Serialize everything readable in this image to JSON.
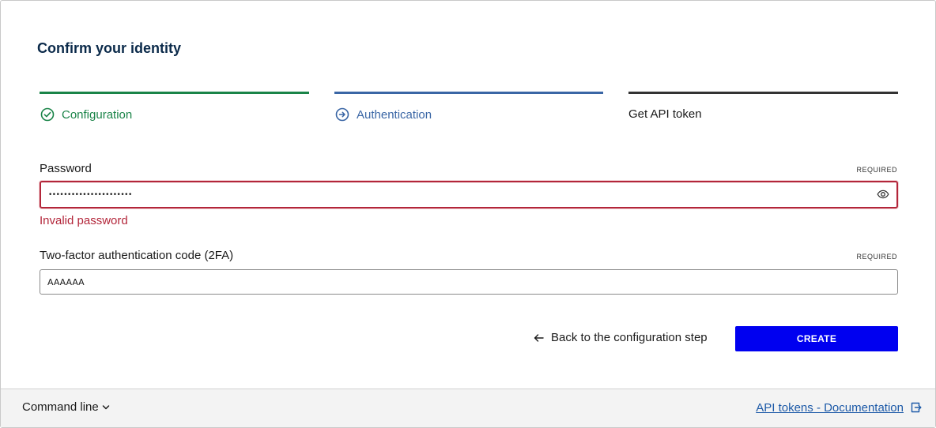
{
  "page": {
    "title": "Confirm your identity"
  },
  "steps": [
    {
      "label": "Configuration",
      "state": "done",
      "color": "#1a8448",
      "icon": "check-circle-icon"
    },
    {
      "label": "Authentication",
      "state": "current",
      "color": "#3a66a5",
      "icon": "arrow-circle-icon"
    },
    {
      "label": "Get API token",
      "state": "pending",
      "color": "#333333"
    }
  ],
  "password": {
    "label": "Password",
    "required": "REQUIRED",
    "value": "••••••••••••••••••••••",
    "error": "Invalid password",
    "toggle_icon": "eye-icon"
  },
  "twofa": {
    "label": "Two-factor authentication code (2FA)",
    "required": "REQUIRED",
    "value": "AAAAAA"
  },
  "actions": {
    "back_label": "Back to the configuration step",
    "back_icon": "arrow-left-icon",
    "create_label": "CREATE"
  },
  "footer": {
    "command_line_label": "Command line",
    "docs_link_label": "API tokens - Documentation",
    "docs_icon": "external-link-icon"
  },
  "colors": {
    "primary_button": "#0000f0",
    "error": "#b3263a",
    "link": "#1d5aa8",
    "title": "#0b2a4a"
  }
}
